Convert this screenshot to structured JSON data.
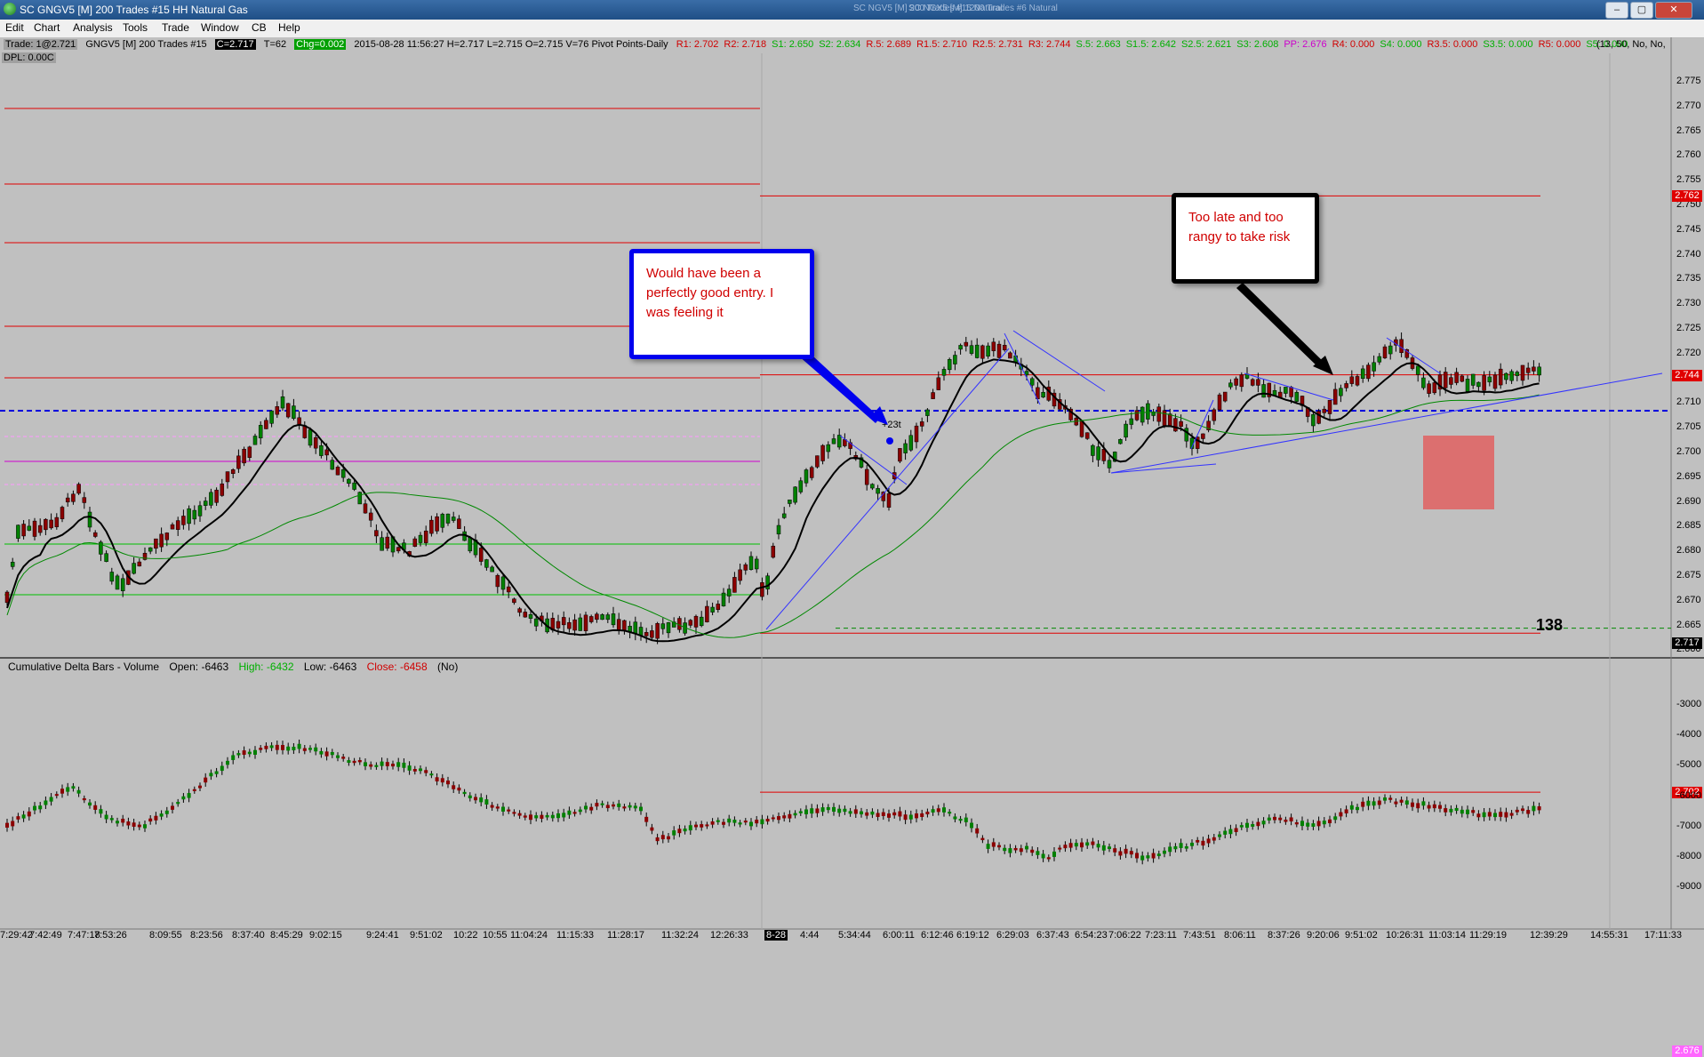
{
  "window": {
    "title": "SC GNGV5 [M]  200 Trades  #15  HH Natural Gas",
    "ghost_titles": [
      "SC NGV5 [M]  200 Trades  #15  Natural",
      "SC NGX5 [M]  1200 Trades  #6  Natural"
    ]
  },
  "menu": [
    "Edit",
    "Chart",
    "Analysis",
    "Tools",
    "Trade",
    "Window",
    "CB",
    "Help"
  ],
  "infobar": {
    "trade": "Trade: 1@2.721",
    "symbol": "GNGV5 [M]  200 Trades  #15",
    "close": "C=2.717",
    "ticks": "T=62",
    "change": "Chg=0.002",
    "ohlc": "2015-08-28 11:56:27 H=2.717 L=2.715 O=2.715 V=76 Pivot Points-Daily",
    "pivots": [
      {
        "t": "R1: 2.702",
        "c": "red"
      },
      {
        "t": "R2: 2.718",
        "c": "red"
      },
      {
        "t": "S1: 2.650",
        "c": "lgrn"
      },
      {
        "t": "S2: 2.634",
        "c": "lgrn"
      },
      {
        "t": "R.5: 2.689",
        "c": "red"
      },
      {
        "t": "R1.5: 2.710",
        "c": "red"
      },
      {
        "t": "R2.5: 2.731",
        "c": "red"
      },
      {
        "t": "R3: 2.744",
        "c": "red"
      },
      {
        "t": "S.5: 2.663",
        "c": "lgrn"
      },
      {
        "t": "S1.5: 2.642",
        "c": "lgrn"
      },
      {
        "t": "S2.5: 2.621",
        "c": "lgrn"
      },
      {
        "t": "S3: 2.608",
        "c": "lgrn"
      },
      {
        "t": "PP: 2.676",
        "c": "mag"
      },
      {
        "t": "R4: 0.000",
        "c": "red"
      },
      {
        "t": "S4: 0.000",
        "c": "lgrn"
      },
      {
        "t": "R3.5: 0.000",
        "c": "red"
      },
      {
        "t": "S3.5: 0.000",
        "c": "lgrn"
      },
      {
        "t": "R5: 0.000",
        "c": "red"
      },
      {
        "t": "S5: 0.000",
        "c": "lgrn"
      }
    ],
    "settings": "(13, 50, No, No,",
    "dpl": "DPL: 0.00C"
  },
  "price_axis": [
    "2.775",
    "2.770",
    "2.765",
    "2.760",
    "2.755",
    "2.750",
    "2.745",
    "2.740",
    "2.735",
    "2.730",
    "2.725",
    "2.720",
    "2.715",
    "2.710",
    "2.705",
    "2.700",
    "2.695",
    "2.690",
    "2.685",
    "2.680",
    "2.675",
    "2.670",
    "2.665",
    "2.660"
  ],
  "price_badges": [
    {
      "value": "2.762",
      "color": "#e00000"
    },
    {
      "value": "2.744",
      "color": "#e00000"
    },
    {
      "value": "2.717",
      "color": "#000000"
    },
    {
      "value": "2.702",
      "color": "#e00000"
    },
    {
      "value": "2.676",
      "color": "#ff66ff"
    }
  ],
  "entry_marker": "+23t",
  "callouts": {
    "entry": "Would have been a perfectly good entry.  I was feeling it",
    "late": "Too late and too rangy to take risk"
  },
  "bar_count": "138",
  "delta_header": {
    "title": "Cumulative Delta Bars - Volume",
    "open": "Open: -6463",
    "high": "High: -6432",
    "low": "Low: -6463",
    "close": "Close: -6458",
    "flag": "(No)"
  },
  "delta_axis": [
    "-3000",
    "-4000",
    "-5000",
    "-6000",
    "-7000",
    "-8000",
    "-9000"
  ],
  "time_axis": [
    "7:29:42",
    "7:42:49",
    "7:47:18",
    "7:53:26",
    "8:09:55",
    "8:23:56",
    "8:37:40",
    "8:45:29",
    "9:02:15",
    "9:24:41",
    "9:51:02",
    "10:22",
    "10:55",
    "11:04:24",
    "11:15:33",
    "11:28:17",
    "11:32:24",
    "12:26:33",
    "8-28",
    "4:44",
    "5:34:44",
    "6:00:11",
    "6:12:46",
    "6:19:12",
    "6:29:03",
    "6:37:43",
    "6:54:23",
    "7:06:22",
    "7:23:11",
    "7:43:51",
    "8:06:11",
    "8:37:26",
    "9:20:06",
    "9:51:02",
    "10:26:31",
    "11:03:14",
    "11:29:19",
    "12:39:29",
    "14:55:31",
    "17:11:33"
  ],
  "colors": {
    "background": "#c0c0c0",
    "resistance": "#e00000",
    "support": "#00c000",
    "pivot": "#ff00ff",
    "trendline": "#3333ff",
    "callout_entry_border": "#0000ee",
    "risk_box": "#e06060"
  }
}
